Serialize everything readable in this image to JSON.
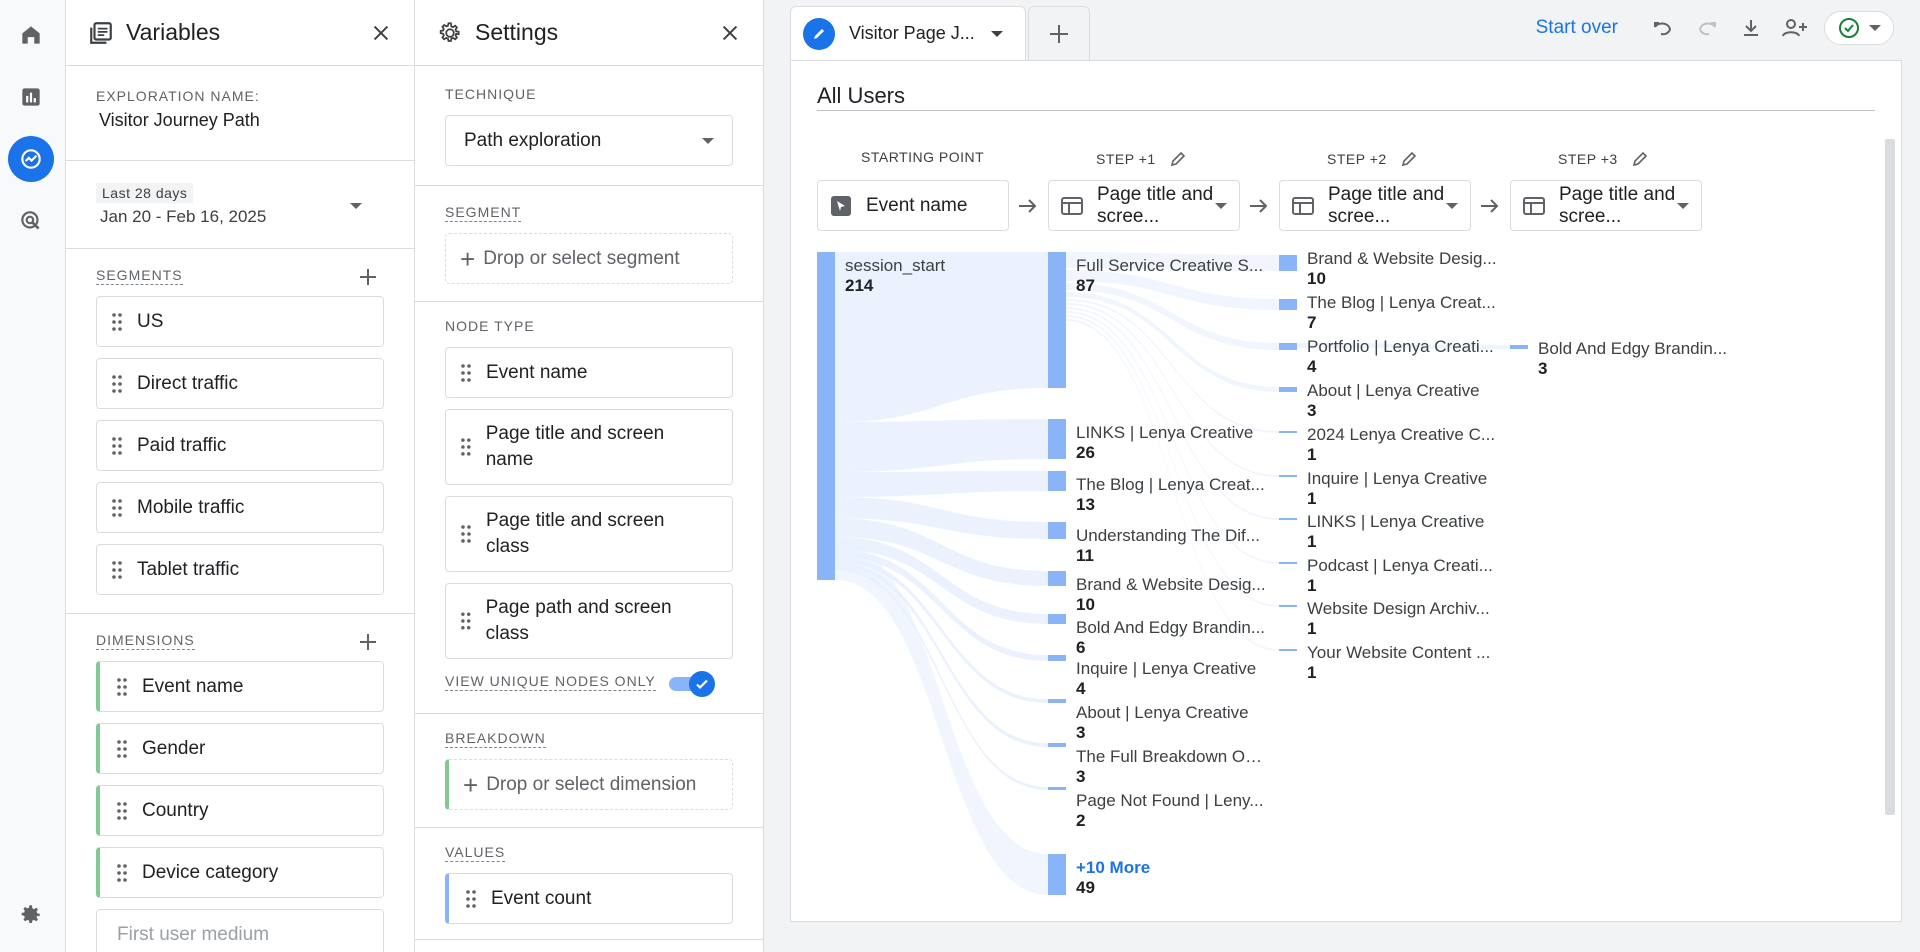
{
  "rail": {
    "items": [
      "home-icon",
      "reports-icon",
      "explore-icon",
      "advertising-icon"
    ],
    "settings": "gear-icon"
  },
  "variables": {
    "title": "Variables",
    "exploration_name_label": "EXPLORATION NAME:",
    "exploration_name": "Visitor Journey Path",
    "date_range_label": "Last 28 days",
    "date_range": "Jan 20 - Feb 16, 2025",
    "segments_label": "SEGMENTS",
    "segments": [
      "US",
      "Direct traffic",
      "Paid traffic",
      "Mobile traffic",
      "Tablet traffic"
    ],
    "dimensions_label": "DIMENSIONS",
    "dimensions": [
      "Event name",
      "Gender",
      "Country",
      "Device category"
    ],
    "dimension_placeholder": "First user medium"
  },
  "settings": {
    "title": "Settings",
    "technique_label": "TECHNIQUE",
    "technique": "Path exploration",
    "segment_label": "SEGMENT",
    "segment_drop": "Drop or select segment",
    "node_type_label": "NODE TYPE",
    "node_types": [
      "Event name",
      "Page title and screen name",
      "Page title and screen class",
      "Page path and screen class"
    ],
    "unique_nodes_label": "VIEW UNIQUE NODES ONLY",
    "unique_nodes_on": true,
    "breakdown_label": "BREAKDOWN",
    "breakdown_drop": "Drop or select dimension",
    "values_label": "VALUES",
    "values_item": "Event count"
  },
  "canvas": {
    "tab_title": "Visitor Page J...",
    "start_over": "Start over",
    "segment_title": "All Users",
    "steps": [
      {
        "label": "STARTING POINT",
        "box": "Event name"
      },
      {
        "label": "STEP +1",
        "box": "Page title and scree..."
      },
      {
        "label": "STEP +2",
        "box": "Page title and scree..."
      },
      {
        "label": "STEP +3",
        "box": "Page title and scree..."
      }
    ],
    "start_node": {
      "name": "session_start",
      "value": "214"
    },
    "step1_nodes": [
      {
        "name": "Full Service Creative S...",
        "value": "87"
      },
      {
        "name": "LINKS | Lenya Creative",
        "value": "26"
      },
      {
        "name": "The Blog | Lenya Creat...",
        "value": "13"
      },
      {
        "name": "Understanding The Dif...",
        "value": "11"
      },
      {
        "name": "Brand & Website Desig...",
        "value": "10"
      },
      {
        "name": "Bold And Edgy Brandin...",
        "value": "6"
      },
      {
        "name": "Inquire | Lenya Creative",
        "value": "4"
      },
      {
        "name": "About | Lenya Creative",
        "value": "3"
      },
      {
        "name": "The Full Breakdown Of ...",
        "value": "3"
      },
      {
        "name": "Page Not Found | Leny...",
        "value": "2"
      }
    ],
    "step1_more": {
      "name": "+10 More",
      "value": "49"
    },
    "step2_nodes": [
      {
        "name": "Brand & Website Desig...",
        "value": "10"
      },
      {
        "name": "The Blog | Lenya Creat...",
        "value": "7"
      },
      {
        "name": "Portfolio | Lenya Creati...",
        "value": "4"
      },
      {
        "name": "About | Lenya Creative",
        "value": "3"
      },
      {
        "name": "2024 Lenya Creative C...",
        "value": "1"
      },
      {
        "name": "Inquire | Lenya Creative",
        "value": "1"
      },
      {
        "name": "LINKS | Lenya Creative",
        "value": "1"
      },
      {
        "name": "Podcast | Lenya Creati...",
        "value": "1"
      },
      {
        "name": "Website Design Archiv...",
        "value": "1"
      },
      {
        "name": "Your Website Content ...",
        "value": "1"
      }
    ],
    "step3_nodes": [
      {
        "name": "Bold And Edgy Brandin...",
        "value": "3"
      }
    ]
  }
}
